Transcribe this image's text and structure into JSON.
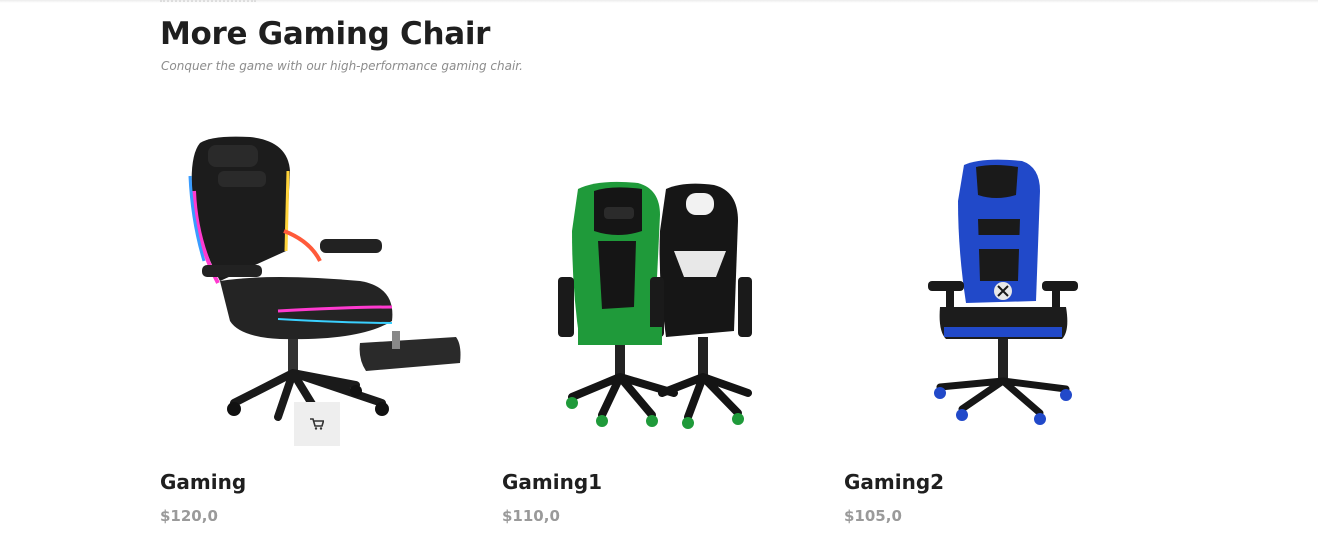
{
  "section": {
    "title": "More Gaming Chair",
    "subtitle": "Conquer the game with our high-performance gaming chair."
  },
  "products": [
    {
      "name": "Gaming",
      "price": "$120,0",
      "image_icon": "gaming-chair-rgb-black",
      "accent": "#1e1e1e"
    },
    {
      "name": "Gaming1",
      "price": "$110,0",
      "image_icon": "gaming-chair-green-black",
      "accent": "#1f9a3a"
    },
    {
      "name": "Gaming2",
      "price": "$105,0",
      "image_icon": "gaming-chair-blue-black",
      "accent": "#2149c9"
    }
  ],
  "cart_icon": "cart-icon"
}
